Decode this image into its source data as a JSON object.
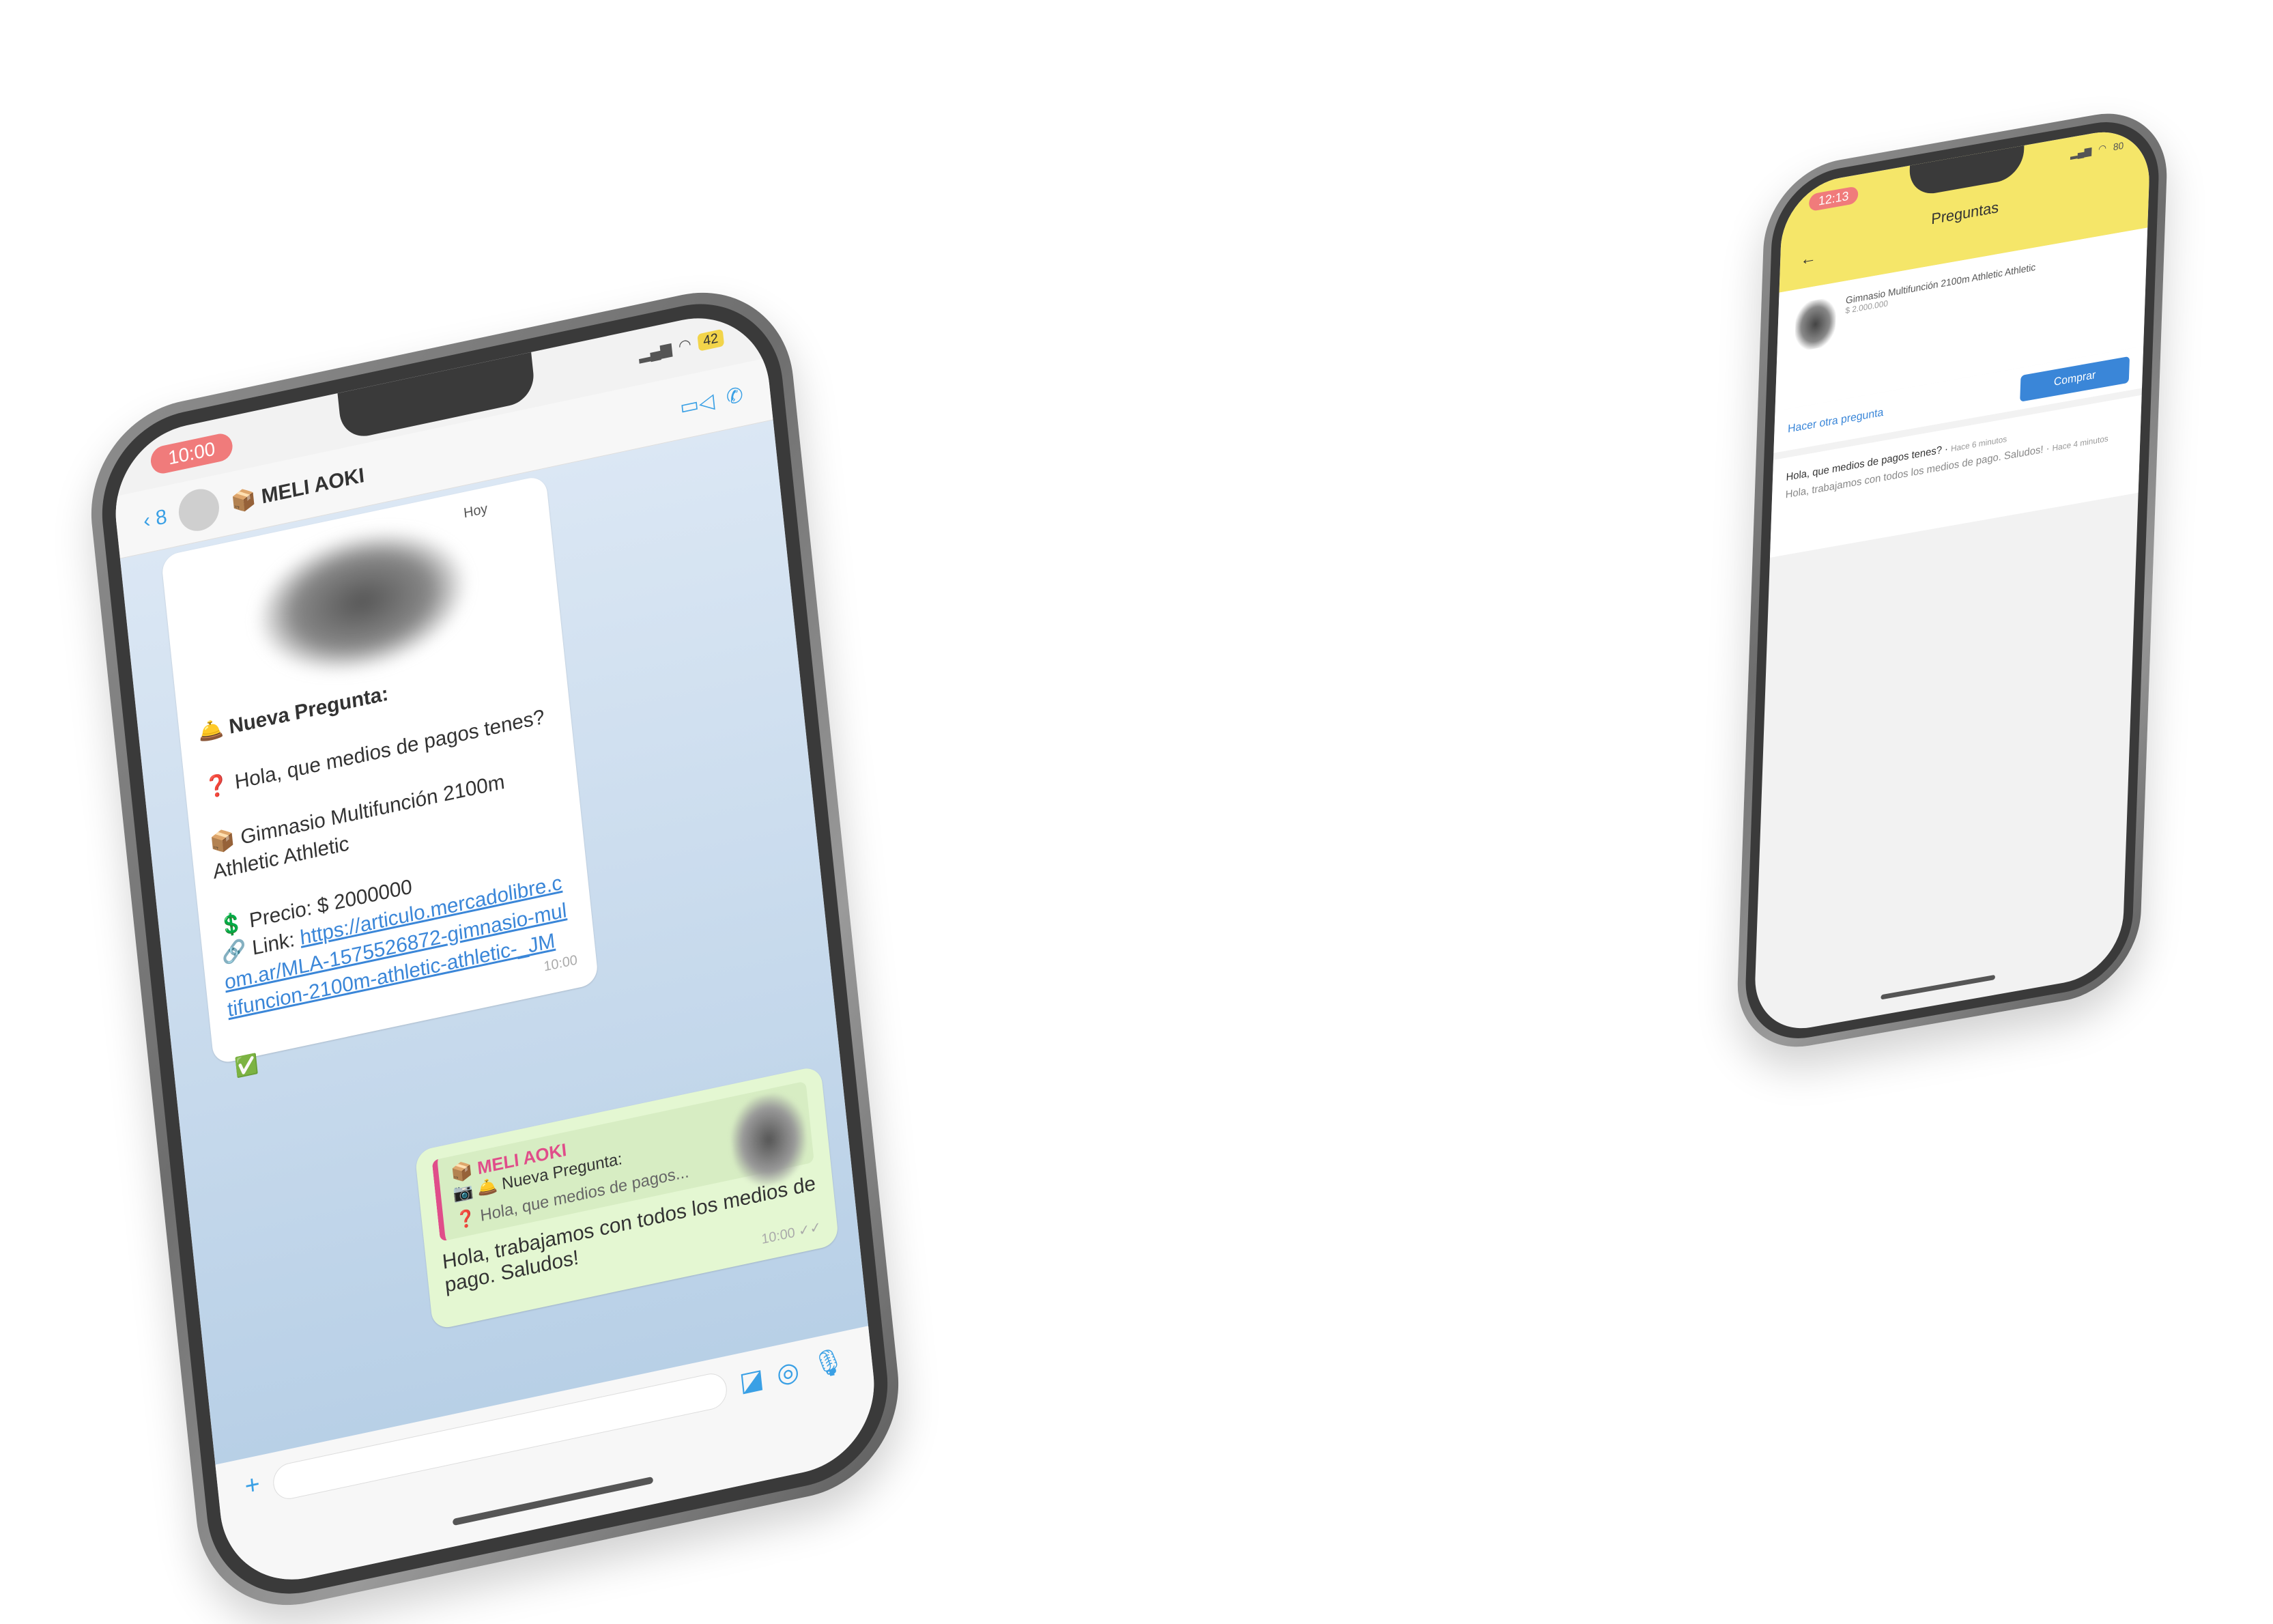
{
  "left_phone": {
    "status": {
      "time": "10:00",
      "battery": "42"
    },
    "header": {
      "back_count": "8",
      "contact_name": "📦 MELI  AOKI"
    },
    "chat": {
      "date_chip": "Hoy",
      "incoming": {
        "title": "🛎️ Nueva Pregunta:",
        "question": "❓ Hola, que medios de pagos tenes?",
        "product": "📦 Gimnasio Multifunción 2100m Athletic Athletic",
        "price": "💲 Precio: $ 2000000",
        "link_label": "🔗 Link: ",
        "link": "https://articulo.mercadolibre.com.ar/MLA-1575526872-gimnasio-multifuncion-2100m-athletic-athletic-_JM",
        "time": "10:00",
        "reaction": "✅"
      },
      "outgoing": {
        "quote_name": "📦 MELI  AOKI",
        "quote_title": "📷 🛎️ Nueva Pregunta:",
        "quote_text": "❓ Hola, que medios de pagos...",
        "text": "Hola, trabajamos con todos los medios de pago. Saludos!",
        "time": "10:00 ✓✓"
      }
    }
  },
  "right_phone": {
    "status": {
      "time": "12:13",
      "battery": "80"
    },
    "header": {
      "title": "Preguntas",
      "back": "←"
    },
    "product": {
      "name": "Gimnasio Multifunción 2100m Athletic Athletic",
      "price": "$ 2.000.000"
    },
    "actions": {
      "ask": "Hacer otra pregunta",
      "buy": "Comprar"
    },
    "qa": {
      "question": "Hola, que medios de pagos tenes?",
      "question_meta": "Hace 6 minutos",
      "answer": "Hola, trabajamos con todos los medios de pago. Saludos!",
      "answer_meta": "Hace 4 minutos"
    }
  }
}
